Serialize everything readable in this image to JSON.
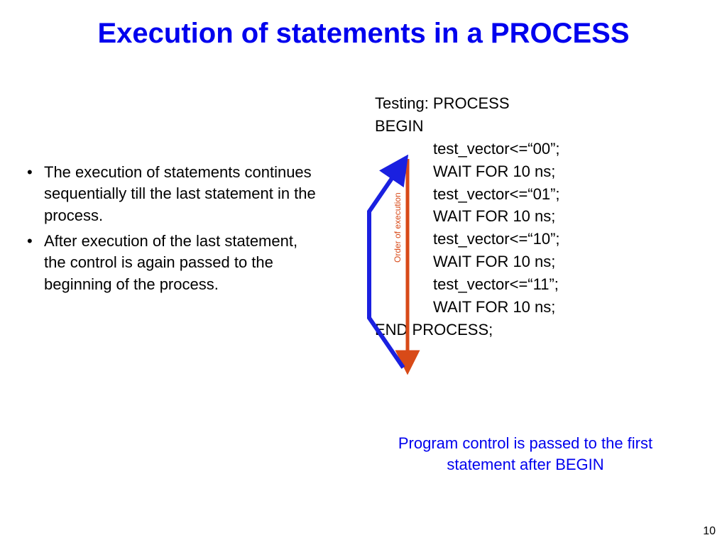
{
  "title": "Execution of statements in a PROCESS",
  "bullets": [
    "The execution of statements continues sequentially till the last statement in the process.",
    "After execution of the last statement, the control is again passed to the beginning of the process."
  ],
  "code": {
    "l0": "Testing: PROCESS",
    "l1": "BEGIN",
    "l2": "test_vector<=“00”;",
    "l3": "WAIT FOR 10 ns;",
    "l4": "test_vector<=“01”;",
    "l5": "WAIT FOR 10 ns;",
    "l6": "test_vector<=“10”;",
    "l7": "WAIT FOR 10 ns;",
    "l8": "test_vector<=“11”;",
    "l9": "WAIT FOR 10 ns;",
    "l10": "END PROCESS;"
  },
  "arrow_label": "Order of execution",
  "caption": "Program control is passed to the first statement after BEGIN",
  "page_number": "10",
  "colors": {
    "title_blue": "#0000ee",
    "orange_arrow": "#d84a18",
    "blue_arrow": "#1a20e0"
  }
}
